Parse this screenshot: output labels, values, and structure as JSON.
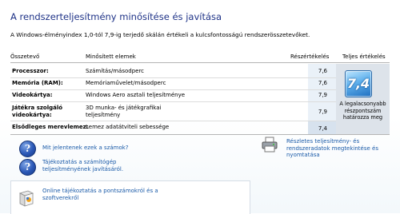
{
  "header": {
    "title": "A rendszerteljesítmény minősítése és javítása",
    "subtitle": "A Windows-élményindex 1,0-tól 7,9-ig terjedő skálán értékeli a kulcsfontosságú rendszerösszetevőket."
  },
  "table": {
    "columns": {
      "component": "Összetevő",
      "rated": "Minősített elemek",
      "subscore": "Részértékelés",
      "base": "Teljes értékelés"
    },
    "rows": [
      {
        "component": "Processzor:",
        "rated": "Számítás/másodperc",
        "subscore": "7,6"
      },
      {
        "component": "Memória (RAM):",
        "rated": "Memóriaművelet/másodperc",
        "subscore": "7,6"
      },
      {
        "component": "Videokártya:",
        "rated": "Windows Aero asztali teljesítménye",
        "subscore": "7,9"
      },
      {
        "component": "Játékra szolgáló videokártya:",
        "rated": "3D munka- és játékgrafikai teljesítmény",
        "subscore": "7,9"
      },
      {
        "component": "Elsődleges merevlemez:",
        "rated": "Lemez adatátviteli sebessége",
        "subscore": "7,4"
      }
    ]
  },
  "base_score": {
    "value": "7,4",
    "caption": "A legalacsonyabb részpontszám határozza meg"
  },
  "links": {
    "meaning": "Mit jelentenek ezek a számok?",
    "tips": "Tájékoztatás a számítógép teljesítményének javításáról.",
    "print": "Részletes teljesítmény- és rendszeradatok megtekintése és nyomtatása",
    "online": "Online tájékoztatás a pontszámokról és a szoftverekről"
  },
  "colors": {
    "title": "#1e3287",
    "link": "#1a5aa8",
    "badge": "#3c8fdb"
  }
}
